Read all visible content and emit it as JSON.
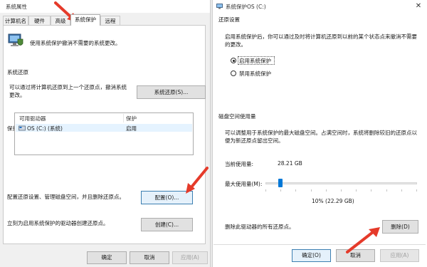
{
  "left_window": {
    "title": "系统属性",
    "tabs": [
      "计算机名",
      "硬件",
      "高级",
      "系统保护",
      "远程"
    ],
    "intro_text": "使用系统保护撤消不需要的系统更改。",
    "restore_section": {
      "heading": "系统还原",
      "description": "可以通过将计算机还原到上一个还原点，撤消系统更改。",
      "button": "系统还原(S)..."
    },
    "protection_section": {
      "heading": "保护设置",
      "columns": [
        "可用驱动器",
        "保护"
      ],
      "rows": [
        {
          "drive": "OS (C:) (系统)",
          "protection": "启用"
        }
      ],
      "configure_text": "配置还原设置、管理磁盘空间，并且删除还原点。",
      "configure_button": "配置(O)...",
      "create_text": "立刻为启用系统保护的驱动器创建还原点。",
      "create_button": "创建(C)..."
    },
    "footer": {
      "ok": "确定",
      "cancel": "取消",
      "apply": "应用(A)"
    },
    "close_glyph": "✕"
  },
  "right_window": {
    "title": "系统保护OS (C:)",
    "close_glyph": "✕",
    "restore_settings": {
      "heading": "还原设置",
      "description": "启用系统保护后，你可以通过及时将计算机还原到以前的某个状态点来撤消不需要的更改。",
      "options": [
        {
          "label": "启用系统保护",
          "checked": true
        },
        {
          "label": "禁用系统保护",
          "checked": false
        }
      ]
    },
    "disk_usage": {
      "heading": "磁盘空间使用量",
      "description": "可以调整用于系统保护的最大磁盘空间。占满空间时，系统将删除较旧的还原点以便为新还原点留出空间。",
      "current_label": "当前使用量:",
      "current_value": "28.21 GB",
      "max_label": "最大使用量(M):",
      "max_fraction": 0.1,
      "slider_value_text": "10% (22.29 GB)",
      "delete_text": "删除此驱动器的所有还原点。",
      "delete_button": "删除(D)"
    },
    "footer": {
      "ok": "确定(O)",
      "cancel": "取消",
      "apply": "应用(A)"
    }
  },
  "colors": {
    "arrow": "#e53a2a",
    "accent": "#0078d7",
    "selection": "#e5f3ff"
  }
}
